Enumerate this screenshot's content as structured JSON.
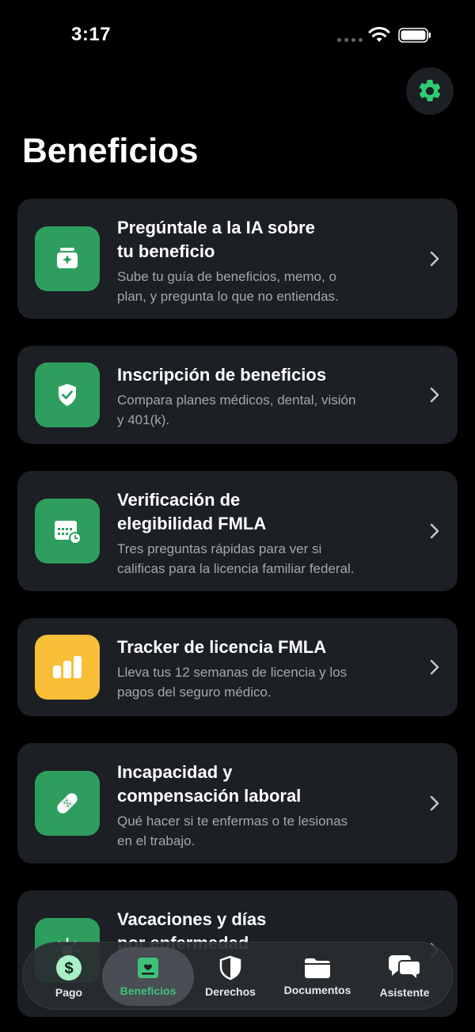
{
  "status_bar": {
    "time": "3:17"
  },
  "header": {
    "title": "Beneficios",
    "settings_icon": "gear-icon"
  },
  "colors": {
    "accent": "#2e9e5f",
    "warning": "#f7be36",
    "card_bg": "#1c1f24",
    "muted_text": "#a3a7ad",
    "tab_active": "#3ec27a"
  },
  "cards": [
    {
      "icon": "ai-sparkle-icon",
      "title_1": "Pregúntale a la IA sobre",
      "title_2": "tu beneficio",
      "desc_1": "Sube tu guía de beneficios, memo, o",
      "desc_2": "plan, y pregunta lo que no entiendas."
    },
    {
      "icon": "shield-check-icon",
      "title_1": "Inscripción de beneficios",
      "desc_1": "Compara planes médicos, dental, visión",
      "desc_2": "y 401(k)."
    },
    {
      "icon": "calendar-clock-icon",
      "title_1": "Verificación de",
      "title_2": "elegibilidad FMLA",
      "desc_1": "Tres preguntas rápidas para ver si",
      "desc_2": "calificas para la licencia familiar federal."
    },
    {
      "icon": "bar-chart-icon",
      "title_1": "Tracker de licencia FMLA",
      "desc_1": "Lleva tus 12 semanas de licencia y los",
      "desc_2": "pagos del seguro médico."
    },
    {
      "icon": "bandage-icon",
      "title_1": "Incapacidad y",
      "title_2": "compensación laboral",
      "desc_1": "Qué hacer si te enfermas o te lesionas",
      "desc_2": "en el trabajo."
    },
    {
      "icon": "sun-icon",
      "title_1": "Vacaciones y días",
      "title_2": "por enfermedad"
    }
  ],
  "tabbar": {
    "tabs": [
      {
        "label": "Pago",
        "icon": "dollar-icon"
      },
      {
        "label": "Beneficios",
        "icon": "id-card-icon",
        "active": true
      },
      {
        "label": "Derechos",
        "icon": "shield-icon"
      },
      {
        "label": "Documentos",
        "icon": "folder-icon"
      },
      {
        "label": "Asistente",
        "icon": "chat-bubbles-icon"
      }
    ]
  }
}
